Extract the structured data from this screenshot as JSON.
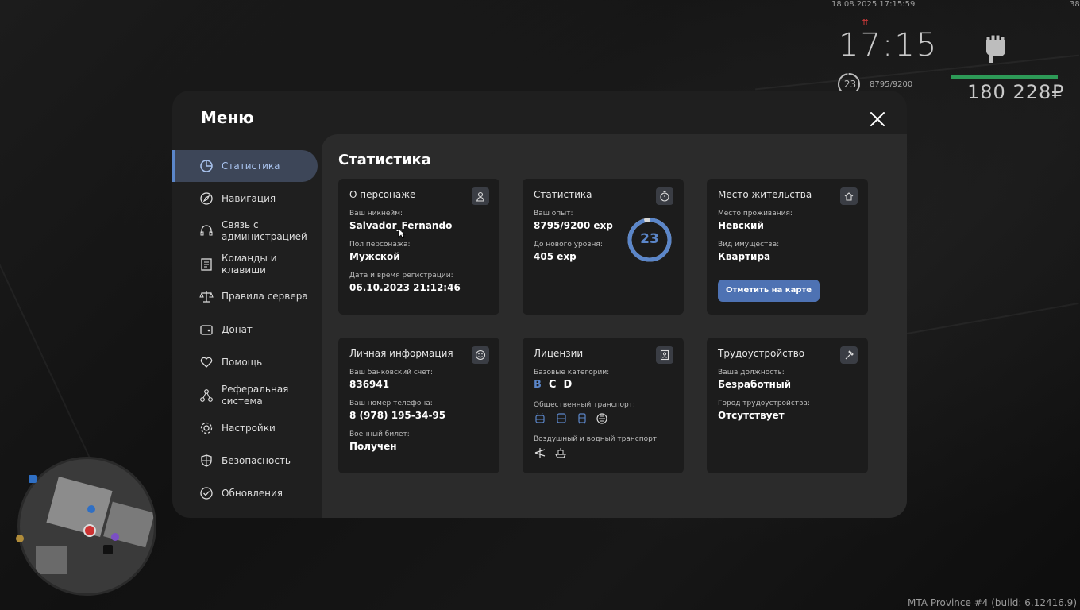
{
  "hud": {
    "datetime": "18.08.2025 17:15:59",
    "fps": "38",
    "clock": "17:15",
    "level": "23",
    "exp": "8795/9200",
    "money": "180 228₽"
  },
  "build_text": "MTA Province #4 (build: 6.12416.9)",
  "menu": {
    "title": "Меню",
    "sidebar": [
      {
        "label": "Статистика",
        "icon": "pie-chart-icon",
        "active": true
      },
      {
        "label": "Навигация",
        "icon": "compass-icon"
      },
      {
        "label": "Связь с администрацией",
        "icon": "headset-icon"
      },
      {
        "label": "Команды и клавиши",
        "icon": "document-icon"
      },
      {
        "label": "Правила сервера",
        "icon": "scales-icon"
      },
      {
        "label": "Донат",
        "icon": "wallet-icon"
      },
      {
        "label": "Помощь",
        "icon": "heart-hand-icon"
      },
      {
        "label": "Реферальная система",
        "icon": "network-icon"
      },
      {
        "label": "Настройки",
        "icon": "gear-icon"
      },
      {
        "label": "Безопасность",
        "icon": "shield-icon"
      },
      {
        "label": "Обновления",
        "icon": "check-circle-icon"
      }
    ],
    "content_title": "Статистика",
    "cards": {
      "character": {
        "title": "О персонаже",
        "nick_label": "Ваш никнейм:",
        "nick": "Salvador_Fernando",
        "gender_label": "Пол персонажа:",
        "gender": "Мужской",
        "reg_label": "Дата и время регистрации:",
        "reg": "06.10.2023 21:12:46"
      },
      "stats": {
        "title": "Статистика",
        "exp_label": "Ваш опыт:",
        "exp": "8795/9200 exp",
        "next_label": "До нового уровня:",
        "next": "405 exp",
        "level": "23",
        "level_progress": 0.956
      },
      "residence": {
        "title": "Место жительства",
        "place_label": "Место проживания:",
        "place": "Невский",
        "type_label": "Вид имущества:",
        "type": "Квартира",
        "map_button": "Отметить на карте"
      },
      "personal": {
        "title": "Личная информация",
        "bank_label": "Ваш банковский счет:",
        "bank": "836941",
        "phone_label": "Ваш номер телефона:",
        "phone": "8 (978) 195-34-95",
        "military_label": "Военный билет:",
        "military": "Получен"
      },
      "licenses": {
        "title": "Лицензии",
        "basic_label": "Базовые категории:",
        "categories": [
          {
            "label": "B",
            "active": true
          },
          {
            "label": "C",
            "active": false
          },
          {
            "label": "D",
            "active": false
          }
        ],
        "public_label": "Общественный транспорт:",
        "public_icons": [
          "trolleybus-icon",
          "bus-icon",
          "tram-icon",
          "metro-icon"
        ],
        "air_label": "Воздушный и водный транспорт:",
        "air_icons": [
          "plane-icon",
          "boat-icon"
        ]
      },
      "employment": {
        "title": "Трудоустройство",
        "job_label": "Ваша должность:",
        "job": "Безработный",
        "city_label": "Город трудоустройства:",
        "city": "Отсутствует"
      }
    }
  },
  "colors": {
    "accent": "#5b86c9",
    "button": "#4e72b3",
    "hud_bar": "#2d9a57"
  }
}
